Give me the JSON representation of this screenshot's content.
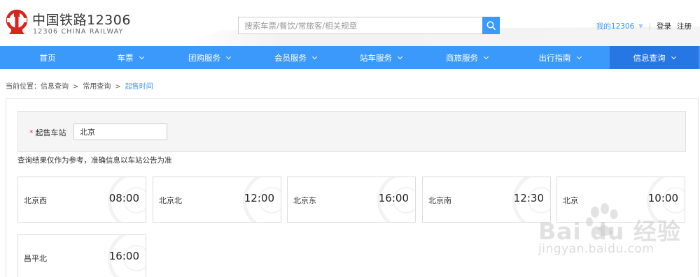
{
  "header": {
    "brand_cn": "中国铁路12306",
    "brand_en": "12306 CHINA RAILWAY",
    "logo_icon": "china-railway-logo-icon",
    "search_placeholder": "搜索车票/餐饮/常旅客/相关规章",
    "search_icon": "search-icon",
    "my_account": "我的12306",
    "login": "登录",
    "register": "注册"
  },
  "nav": {
    "items": [
      {
        "label": "首页",
        "has_dropdown": false
      },
      {
        "label": "车票",
        "has_dropdown": true
      },
      {
        "label": "团购服务",
        "has_dropdown": true
      },
      {
        "label": "会员服务",
        "has_dropdown": true
      },
      {
        "label": "站车服务",
        "has_dropdown": true
      },
      {
        "label": "商旅服务",
        "has_dropdown": true
      },
      {
        "label": "出行指南",
        "has_dropdown": true
      },
      {
        "label": "信息查询",
        "has_dropdown": true,
        "active": true
      }
    ]
  },
  "breadcrumb": {
    "prefix": "当前位置：",
    "items": [
      "信息查询",
      "常用查询",
      "起售时间"
    ],
    "separator": ">"
  },
  "query": {
    "required_mark": "*",
    "label": "起售车站",
    "value": "北京"
  },
  "notice": "查询结果仅作为参考，准确信息以车站公告为准",
  "results": [
    {
      "station": "北京西",
      "time": "08:00"
    },
    {
      "station": "北京北",
      "time": "12:00"
    },
    {
      "station": "北京东",
      "time": "16:00"
    },
    {
      "station": "北京南",
      "time": "12:30"
    },
    {
      "station": "北京",
      "time": "10:00"
    },
    {
      "station": "昌平北",
      "time": "16:00"
    }
  ],
  "watermark": {
    "text": "Bai du 经验",
    "sub": "jingyan.baidu.com"
  },
  "colors": {
    "primary": "#3b99fc",
    "nav_active": "#2676e3",
    "logo_red": "#d9251c",
    "required": "#e53333"
  }
}
